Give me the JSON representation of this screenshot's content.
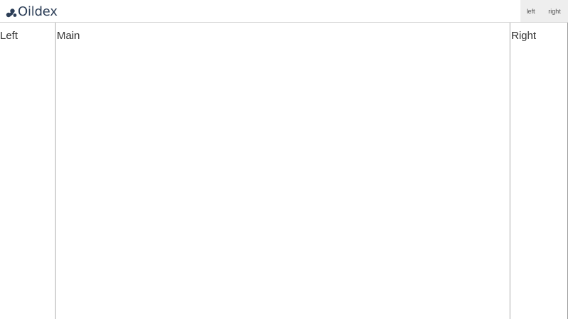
{
  "header": {
    "brand": {
      "name": "Oildex",
      "logo_icon": "oildex-logo-icon",
      "color": "#2c3e57"
    },
    "nav": {
      "left_label": "left",
      "right_label": "right",
      "background": "#eeeeee"
    }
  },
  "panes": {
    "left": {
      "title": "Left"
    },
    "main": {
      "title": "Main"
    },
    "right": {
      "title": "Right"
    }
  }
}
